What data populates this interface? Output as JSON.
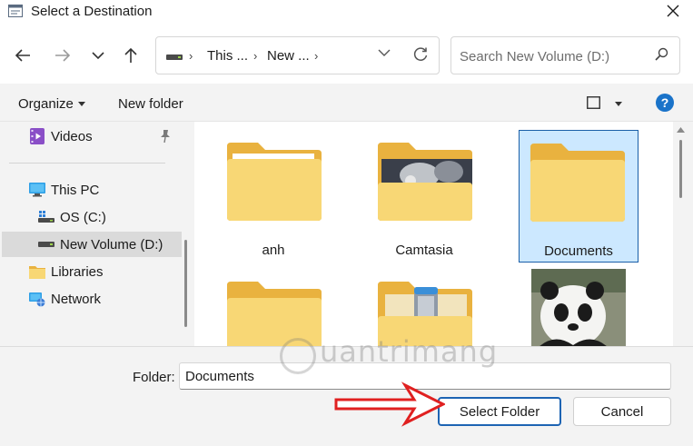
{
  "window": {
    "title": "Select a Destination"
  },
  "address": {
    "crumbs": [
      "This ...",
      "New ..."
    ],
    "search_placeholder": "Search New Volume (D:)"
  },
  "toolbar": {
    "organize_label": "Organize",
    "new_folder_label": "New folder",
    "help_label": "?"
  },
  "sidebar": {
    "items": [
      {
        "label": "Videos",
        "icon": "videos-icon"
      },
      {
        "label": "This PC",
        "icon": "monitor-icon"
      },
      {
        "label": "OS (C:)",
        "icon": "drive-icon"
      },
      {
        "label": "New Volume (D:)",
        "icon": "drive-icon",
        "selected": true
      },
      {
        "label": "Libraries",
        "icon": "library-icon"
      },
      {
        "label": "Network",
        "icon": "network-icon"
      }
    ]
  },
  "content": {
    "items": [
      {
        "label": "anh",
        "type": "folder"
      },
      {
        "label": "Camtasia",
        "type": "folder-with-image"
      },
      {
        "label": "Documents",
        "type": "folder",
        "selected": true
      },
      {
        "label": "",
        "type": "folder"
      },
      {
        "label": "",
        "type": "folder-with-items"
      },
      {
        "label": "",
        "type": "image-panda"
      }
    ]
  },
  "footer": {
    "folder_label": "Folder:",
    "folder_value": "Documents",
    "select_button": "Select Folder",
    "cancel_button": "Cancel"
  },
  "watermark": {
    "text": "uantrimang"
  },
  "colors": {
    "accent": "#1d64b3",
    "folder_yellow": "#f8d775",
    "selection": "#cce8ff",
    "arrow_red": "#e02020"
  }
}
